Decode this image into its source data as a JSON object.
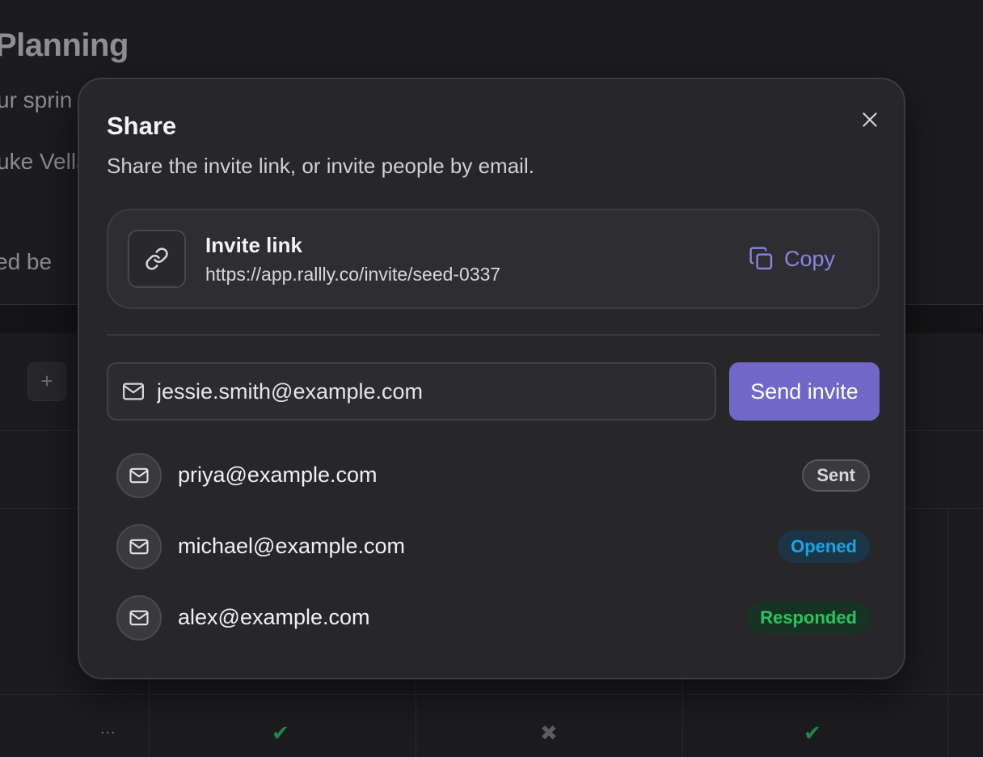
{
  "background": {
    "title": "Planning",
    "description": "ur sprin",
    "author": "uke Vella",
    "note": "ed be",
    "add_symbol": "+",
    "more_symbol": "...",
    "marks": [
      "✔",
      "✖",
      "✔"
    ]
  },
  "dialog": {
    "title": "Share",
    "subtitle": "Share the invite link, or invite people by email.",
    "close_icon": "close-icon",
    "invite_link": {
      "label": "Invite link",
      "url": "https://app.rallly.co/invite/seed-0337",
      "copy_label": "Copy"
    },
    "email_input": {
      "value": "jessie.smith@example.com",
      "placeholder": ""
    },
    "send_label": "Send invite",
    "invites": [
      {
        "email": "priya@example.com",
        "status": "Sent"
      },
      {
        "email": "michael@example.com",
        "status": "Opened"
      },
      {
        "email": "alex@example.com",
        "status": "Responded"
      }
    ]
  },
  "colors": {
    "accent": "#7067c8",
    "copy_text": "#8c83e0",
    "opened": "#12a8e8",
    "responded": "#25c55f",
    "check": "#1f8a45"
  }
}
